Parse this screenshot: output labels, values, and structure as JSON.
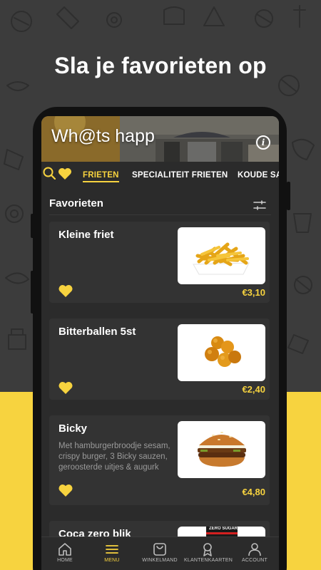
{
  "headline": "Sla je favorieten op",
  "app": {
    "title": "Wh@ts happ",
    "info_label": "i"
  },
  "tabs": [
    {
      "label": "FRIETEN",
      "active": true
    },
    {
      "label": "SPECIALITEIT FRIETEN",
      "active": false
    },
    {
      "label": "KOUDE SA",
      "active": false
    }
  ],
  "section": {
    "title": "Favorieten"
  },
  "items": [
    {
      "name": "Kleine friet",
      "description": "",
      "price": "€3,10",
      "image": "fries"
    },
    {
      "name": "Bitterballen 5st",
      "description": "",
      "price": "€2,40",
      "image": "bitterballen"
    },
    {
      "name": "Bicky",
      "description": "Met hamburgerbroodje sesam, crispy burger, 3 Bicky sauzen, geroosterde uitjes & augurk",
      "price": "€4,80",
      "image": "burger"
    },
    {
      "name": "Coca zero blik",
      "description": "",
      "price": "",
      "image": "can"
    }
  ],
  "bottom_nav": [
    {
      "label": "HOME",
      "icon": "home-icon",
      "active": false
    },
    {
      "label": "MENU",
      "icon": "menu-icon",
      "active": true
    },
    {
      "label": "WINKELMAND",
      "icon": "basket-icon",
      "active": false
    },
    {
      "label": "KLANTENKAARTEN",
      "icon": "award-icon",
      "active": false
    },
    {
      "label": "ACCOUNT",
      "icon": "account-icon",
      "active": false
    }
  ],
  "can_label": "ZERO SUGAR",
  "colors": {
    "accent": "#f7d33f",
    "background": "#3c3c3c",
    "screen": "#2b2b2b",
    "card": "#333333"
  }
}
